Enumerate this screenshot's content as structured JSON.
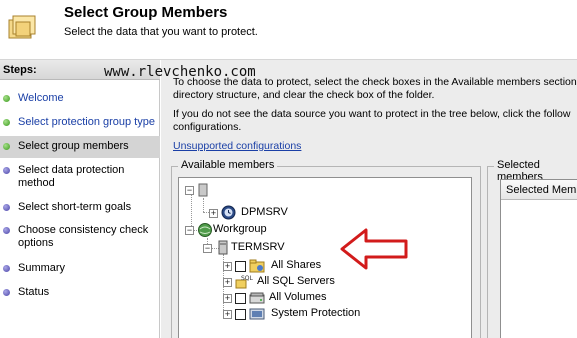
{
  "header": {
    "title": "Select Group Members",
    "subtitle": "Select the data that you want to protect."
  },
  "steps": {
    "heading": "Steps:",
    "items": [
      {
        "label": "Welcome",
        "state": "done"
      },
      {
        "label": "Select protection group type",
        "state": "done"
      },
      {
        "label": "Select group members",
        "state": "current"
      },
      {
        "label": "Select data protection method",
        "state": "pending"
      },
      {
        "label": "Select short-term goals",
        "state": "pending"
      },
      {
        "label": "Choose consistency check options",
        "state": "pending"
      },
      {
        "label": "Summary",
        "state": "pending"
      },
      {
        "label": "Status",
        "state": "pending"
      }
    ]
  },
  "watermark": "www.rlevchenko.com",
  "content": {
    "intro_line1": "To choose the data to protect, select the check boxes in the Available members section",
    "intro_line2": "directory structure, and clear the check box of the folder.",
    "intro_line3": "If you do not see the data source you want to protect in the tree below, click the follow",
    "intro_line4": "configurations.",
    "unsupported_link": "Unsupported configurations"
  },
  "available_members": {
    "title": "Available members",
    "tree": {
      "dpm_server": "DPMSRV",
      "workgroup": "Workgroup",
      "termsrv": "TERMSRV",
      "children": [
        "All Shares",
        "All SQL Servers",
        "All Volumes",
        "System Protection"
      ]
    }
  },
  "selected_members": {
    "title": "Selected members",
    "column_header": "Selected Members"
  },
  "colors": {
    "link": "#1a3fa6",
    "arrow": "#d21b1b",
    "step_done": "#3a9a1c",
    "step_pending": "#4a44a8"
  }
}
